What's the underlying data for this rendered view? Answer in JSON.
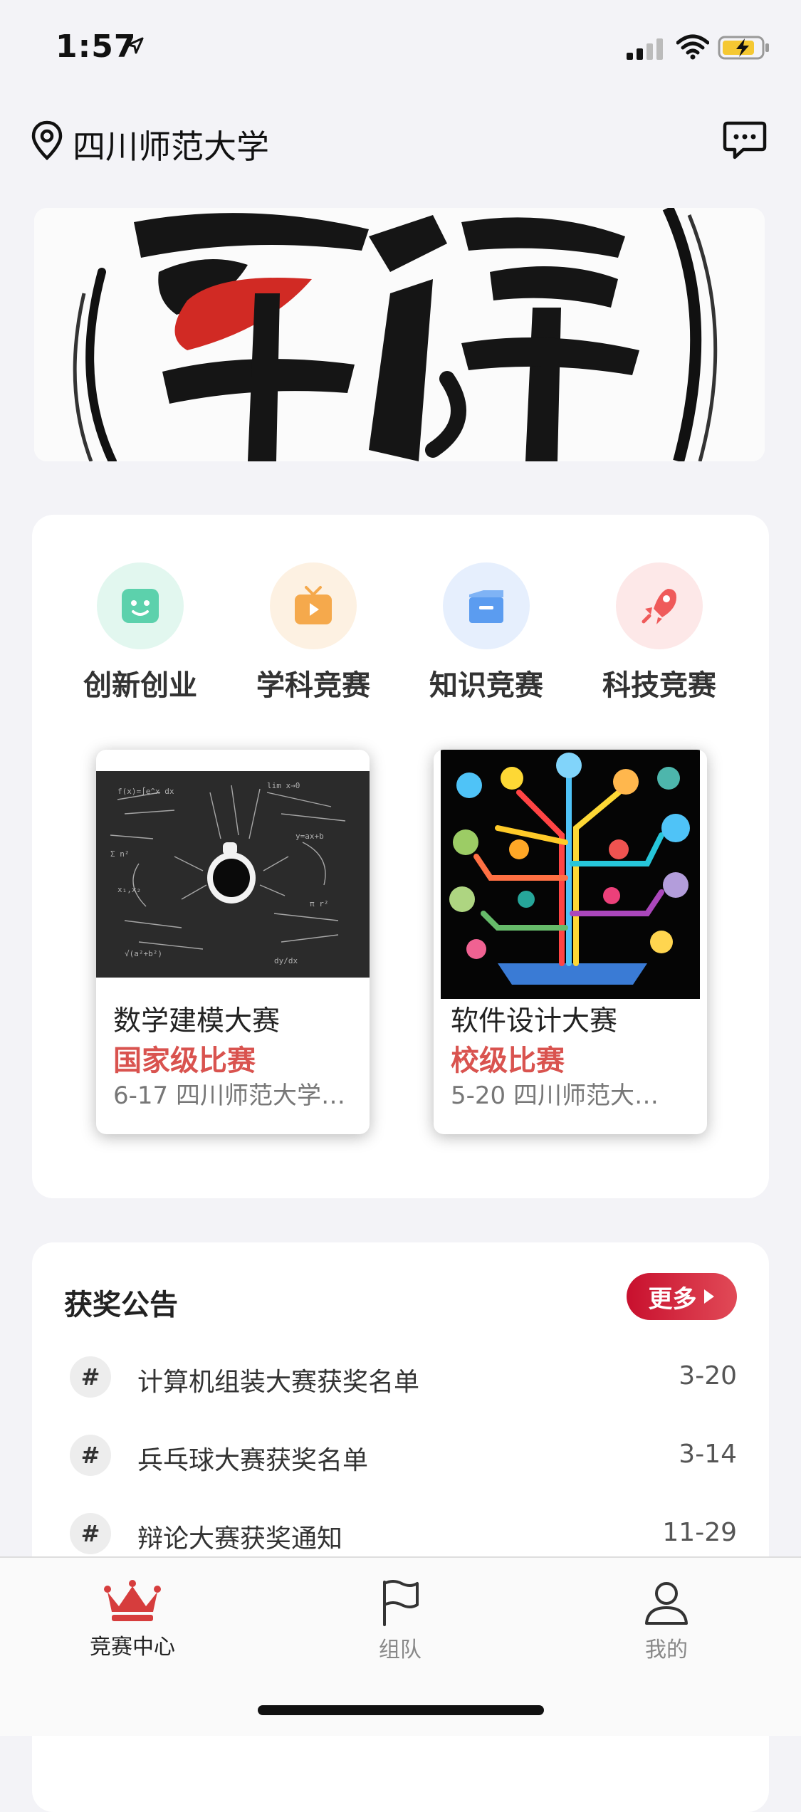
{
  "status_bar": {
    "time": "1:57"
  },
  "header": {
    "location": "四川师范大学"
  },
  "categories": [
    {
      "label": "创新创业",
      "icon": "robot-icon",
      "bg": "#e2f7ef",
      "fg": "#5cd1ac"
    },
    {
      "label": "学科竞赛",
      "icon": "tv-icon",
      "bg": "#fdf1e2",
      "fg": "#f5a94c"
    },
    {
      "label": "知识竞赛",
      "icon": "box-icon",
      "bg": "#e6effd",
      "fg": "#5b9cf0"
    },
    {
      "label": "科技竞赛",
      "icon": "rocket-icon",
      "bg": "#fde8e8",
      "fg": "#ef5a5a"
    }
  ],
  "competitions": [
    {
      "title": "数学建模大赛",
      "level": "国家级比赛",
      "meta": "6-17 四川师范大学…"
    },
    {
      "title": "软件设计大赛",
      "level": "校级比赛",
      "meta": "5-20 四川师范大…"
    }
  ],
  "news": {
    "title": "获奖公告",
    "more_label": "更多",
    "items": [
      {
        "text": "计算机组装大赛获奖名单",
        "date": "3-20"
      },
      {
        "text": "兵乓球大赛获奖名单",
        "date": "3-14"
      },
      {
        "text": "辩论大赛获奖通知",
        "date": "11-29"
      }
    ]
  },
  "tabbar": [
    {
      "label": "竞赛中心",
      "active": true
    },
    {
      "label": "组队",
      "active": false
    },
    {
      "label": "我的",
      "active": false
    }
  ],
  "colors": {
    "accent": "#c8102e",
    "level_red": "#d9534f"
  }
}
